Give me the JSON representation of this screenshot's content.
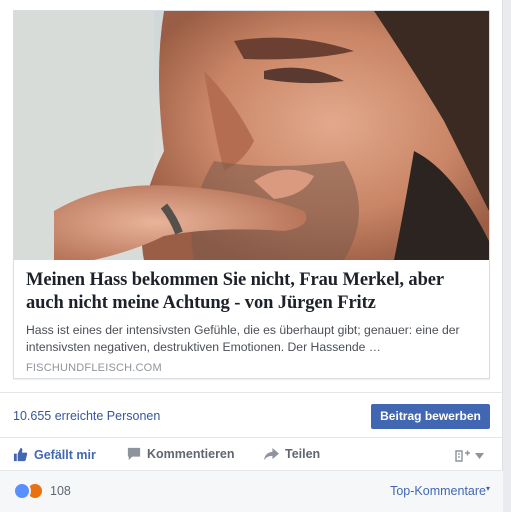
{
  "post": {
    "link": {
      "headline": "Meinen Hass bekommen Sie nicht, Frau Merkel, aber auch nicht meine Achtung - von Jürgen Fritz",
      "description": "Hass ist eines der intensivsten Gefühle, die es überhaupt gibt; genauer: eine der intensivsten negativen, destruktiven Emotionen. Der Hassende …",
      "domain": "FISCHUNDFLEISCH.COM"
    },
    "reach": "10.655 erreichte Personen",
    "promote_button": "Beitrag bewerben",
    "actions": {
      "like": "Gefällt mir",
      "comment": "Kommentieren",
      "share": "Teilen"
    },
    "audience_icon": "page-audience-icon",
    "reactions": {
      "count": "108",
      "types": [
        "like",
        "angry"
      ]
    },
    "sort_label": "Top-Kommentare"
  },
  "colors": {
    "link_blue": "#365899",
    "brand_blue": "#4267b2",
    "like_reaction": "#5890ff",
    "angry_reaction": "#e9710f"
  }
}
